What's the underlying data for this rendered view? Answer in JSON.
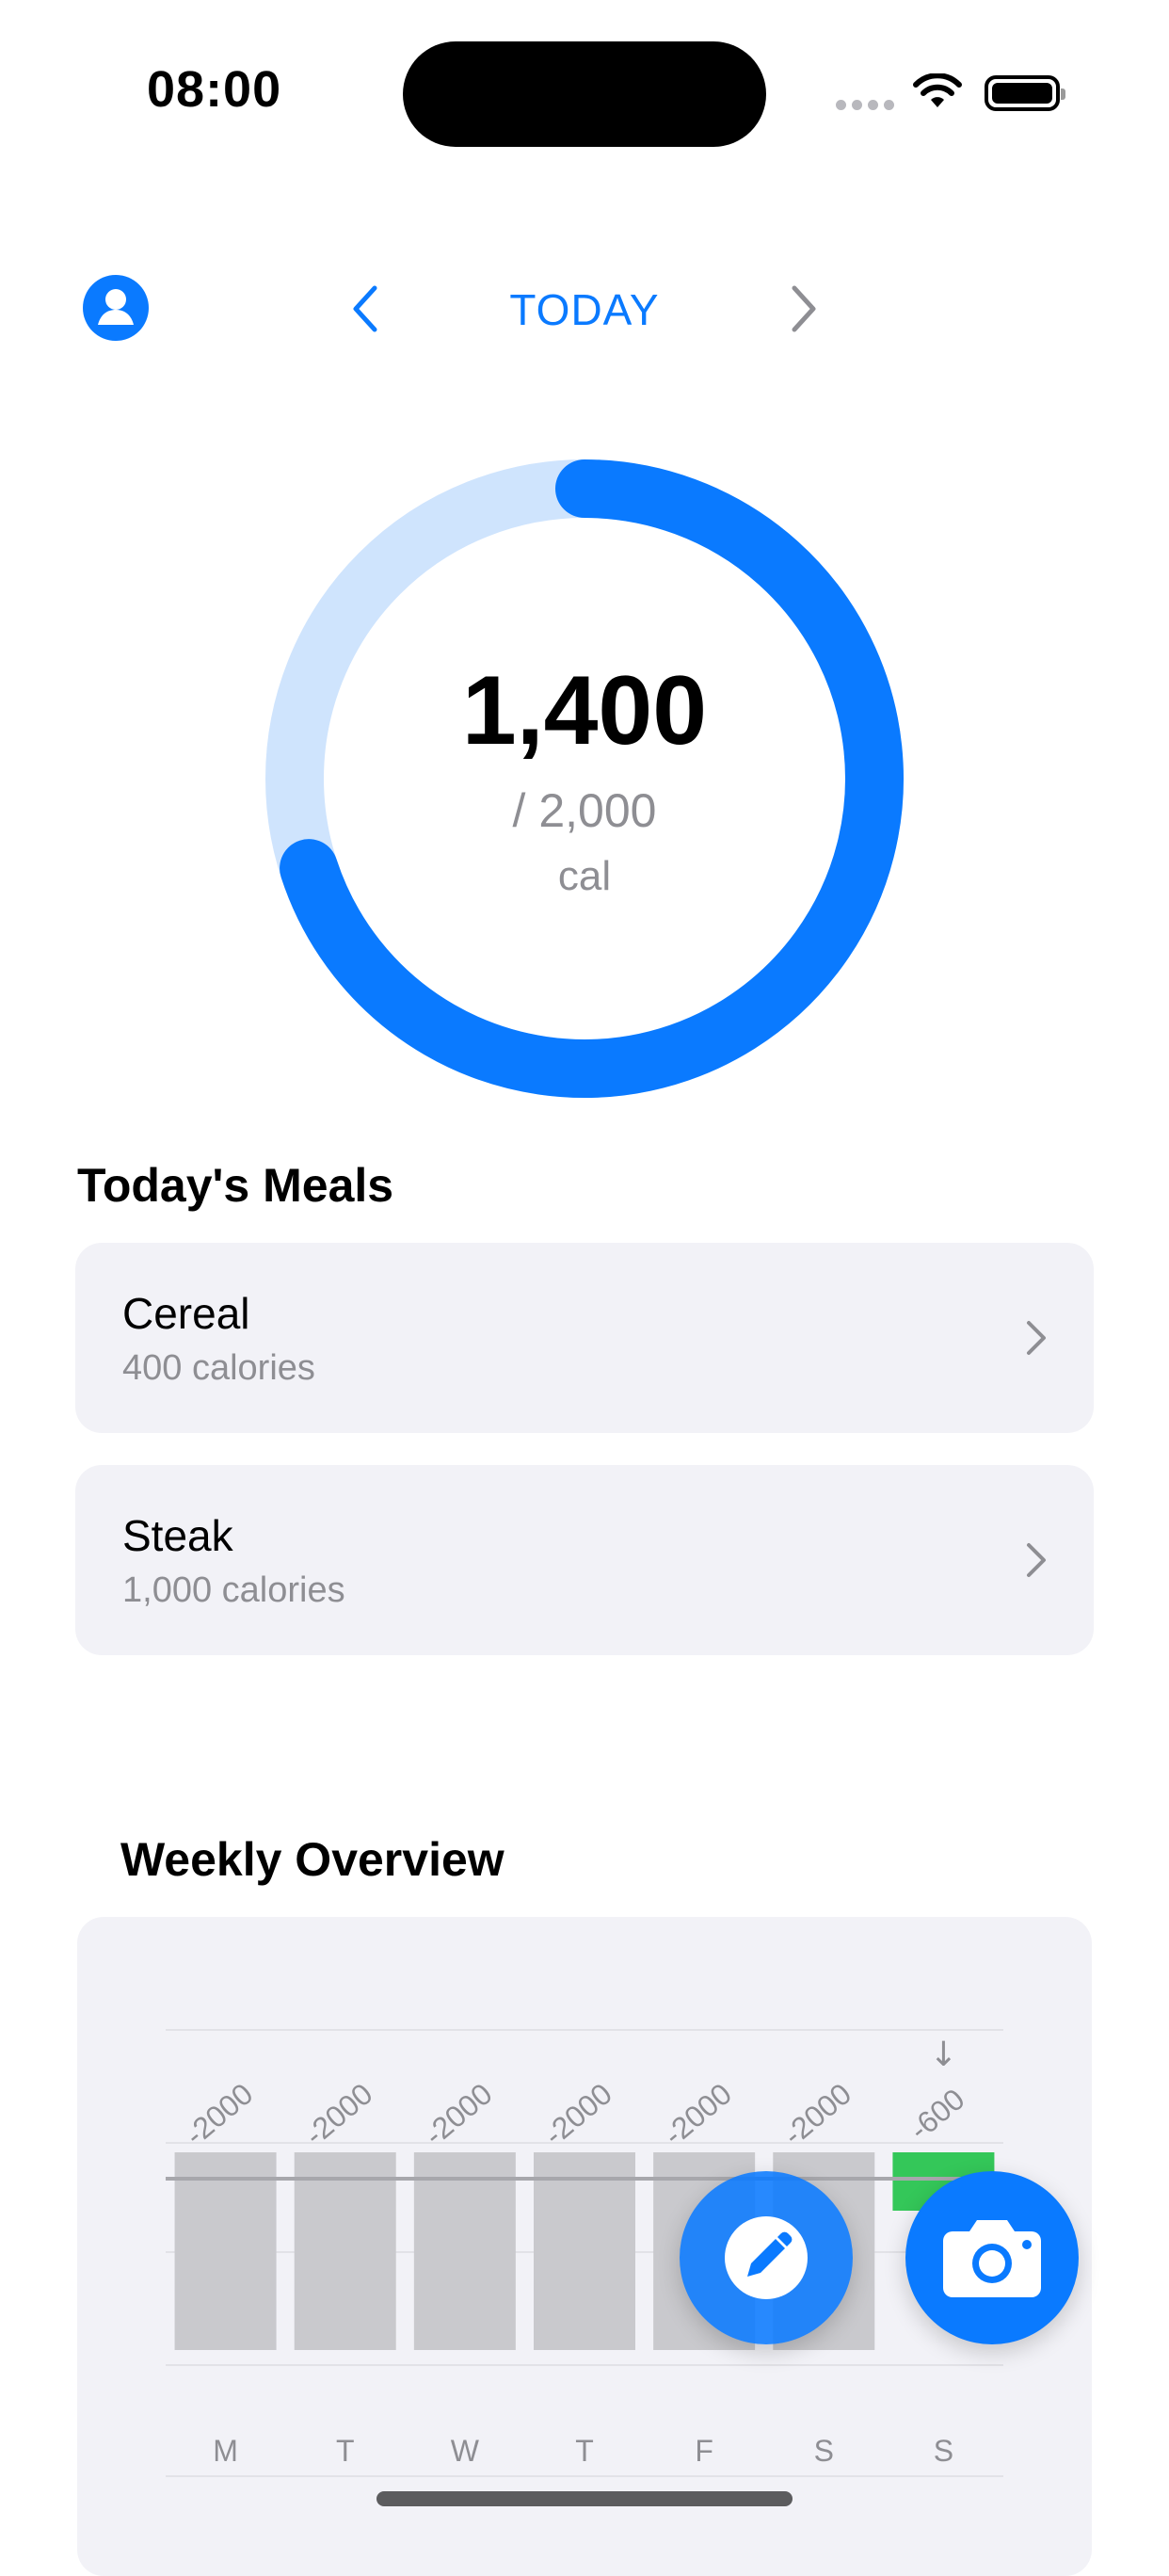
{
  "status_bar": {
    "time": "08:00"
  },
  "header": {
    "title": "TODAY",
    "profile_icon": "person-icon",
    "prev_icon": "chevron-left-icon",
    "next_icon": "chevron-right-icon"
  },
  "calories": {
    "consumed": "1,400",
    "goal_text": "/ 2,000",
    "unit": "cal",
    "progress_fraction": 0.7,
    "ring_color": "#0a7aff",
    "ring_track_color": "#cfe4fd"
  },
  "meals": {
    "title": "Today's Meals",
    "items": [
      {
        "name": "Cereal",
        "calories": "400 calories"
      },
      {
        "name": "Steak",
        "calories": "1,000 calories"
      }
    ]
  },
  "weekly": {
    "title": "Weekly Overview"
  },
  "chart_data": {
    "type": "bar",
    "categories": [
      "M",
      "T",
      "W",
      "T",
      "F",
      "S",
      "S"
    ],
    "values": [
      -2000,
      -2000,
      -2000,
      -2000,
      -2000,
      -2000,
      -600
    ],
    "data_labels": [
      "-2000",
      "-2000",
      "-2000",
      "-2000",
      "-2000",
      "-2000",
      "-600"
    ],
    "highlight_index": 6,
    "highlight_marker": "↓",
    "colors": {
      "default": "#c9c9cd",
      "highlight": "#34c759"
    },
    "grid": true
  },
  "actions": {
    "edit_icon": "pencil-icon",
    "camera_icon": "camera-icon",
    "accent": "#0a7aff"
  }
}
